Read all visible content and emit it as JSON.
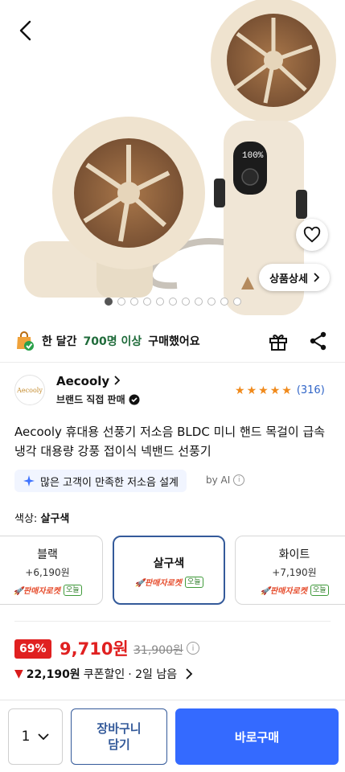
{
  "product_detail": {
    "detail_button_label": "상품상세",
    "image_count": 11,
    "active_image_index": 0
  },
  "purchase_banner": {
    "prefix": "한 달간",
    "highlight": "700명 이상",
    "suffix": "구매했어요"
  },
  "seller": {
    "logo_text": "Aecooly",
    "name": "Aecooly",
    "subtitle": "브랜드 직접 판매"
  },
  "rating": {
    "stars": 5,
    "count": "(316)"
  },
  "title": "Aecooly 휴대용 선풍기 저소음 BLDC 미니 핸드 목걸이 급속 냉각 대용량 강풍 접이식 넥밴드 선풍기",
  "ai_summary": {
    "text": "많은 고객이 만족한 저소음 설계",
    "by": "by AI"
  },
  "color_select": {
    "label": "색상:",
    "selected": "살구색",
    "options": [
      {
        "name": "블랙",
        "price": "+6,190원",
        "badge": "판매자로켓",
        "today": "오늘"
      },
      {
        "name": "살구색",
        "price": "",
        "badge": "판매자로켓",
        "today": "오늘"
      },
      {
        "name": "화이트",
        "price": "+7,190원",
        "badge": "판매자로켓",
        "today": "오늘"
      }
    ]
  },
  "price": {
    "discount": "69%",
    "current": "9,710원",
    "original": "31,900원",
    "coupon_amount": "22,190원",
    "coupon_label": "쿠폰할인",
    "coupon_remaining": "· 2일 남음"
  },
  "bottom_bar": {
    "quantity": "1",
    "cart_line1": "장바구니",
    "cart_line2": "담기",
    "buy_label": "바로구매"
  },
  "colors": {
    "accent_blue": "#346aff",
    "sale_red": "#e02020",
    "rating_star": "#f08a1c",
    "selected_border": "#345a9a"
  }
}
